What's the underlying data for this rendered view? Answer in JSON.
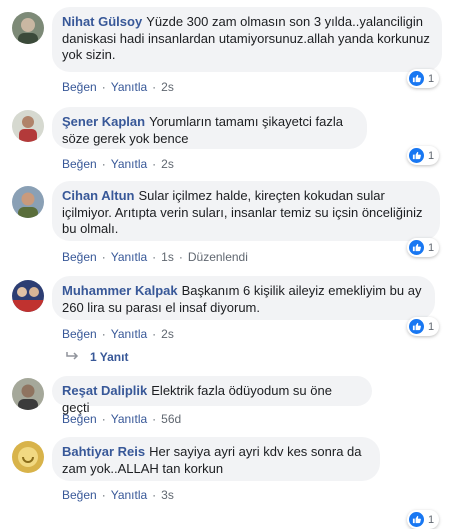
{
  "like_label": "Beğen",
  "reply_label": "Yanıtla",
  "comments": [
    {
      "author": "Nihat Gülsoy",
      "text": "Yüzde 300 zam olmasın son 3 yılda..yalanciligin daniskasi hadi insanlardan utamiyorsunuz.allah yanda korkunuz yok sizin.",
      "time": "2s",
      "likes": "1"
    },
    {
      "author": "Şener Kaplan",
      "text": "Yorumların tamamı şikayetci fazla söze gerek yok bence",
      "time": "2s",
      "likes": "1"
    },
    {
      "author": "Cihan Altun",
      "text": "Sular içilmez halde, kireçten kokudan sular içilmiyor. Arıtıpta verin suları, insanlar temiz su içsin önceliğiniz bu olmalı.",
      "time": "1s",
      "edited": "Düzenlendi",
      "likes": "1"
    },
    {
      "author": "Muhammer Kalpak",
      "text": "Başkanım 6 kişilik aileyiz emekliyim bu ay 260 lira su parası el insaf diyorum.",
      "time": "2s",
      "likes": "1"
    },
    {
      "author": "Reşat Daliplik",
      "text": "Elektrik fazla ödüyodum su öne geçti",
      "time": "56d"
    },
    {
      "author": "Bahtiyar Reis",
      "text": "Her sayiya ayri ayri kdv kes sonra da zam yok..ALLAH tan korkun",
      "time": "3s",
      "likes": "1"
    }
  ],
  "replies_link": "1 Yanıt",
  "colors": {
    "link": "#385898",
    "bubble": "#f2f3f5",
    "like": "#1877f2"
  }
}
